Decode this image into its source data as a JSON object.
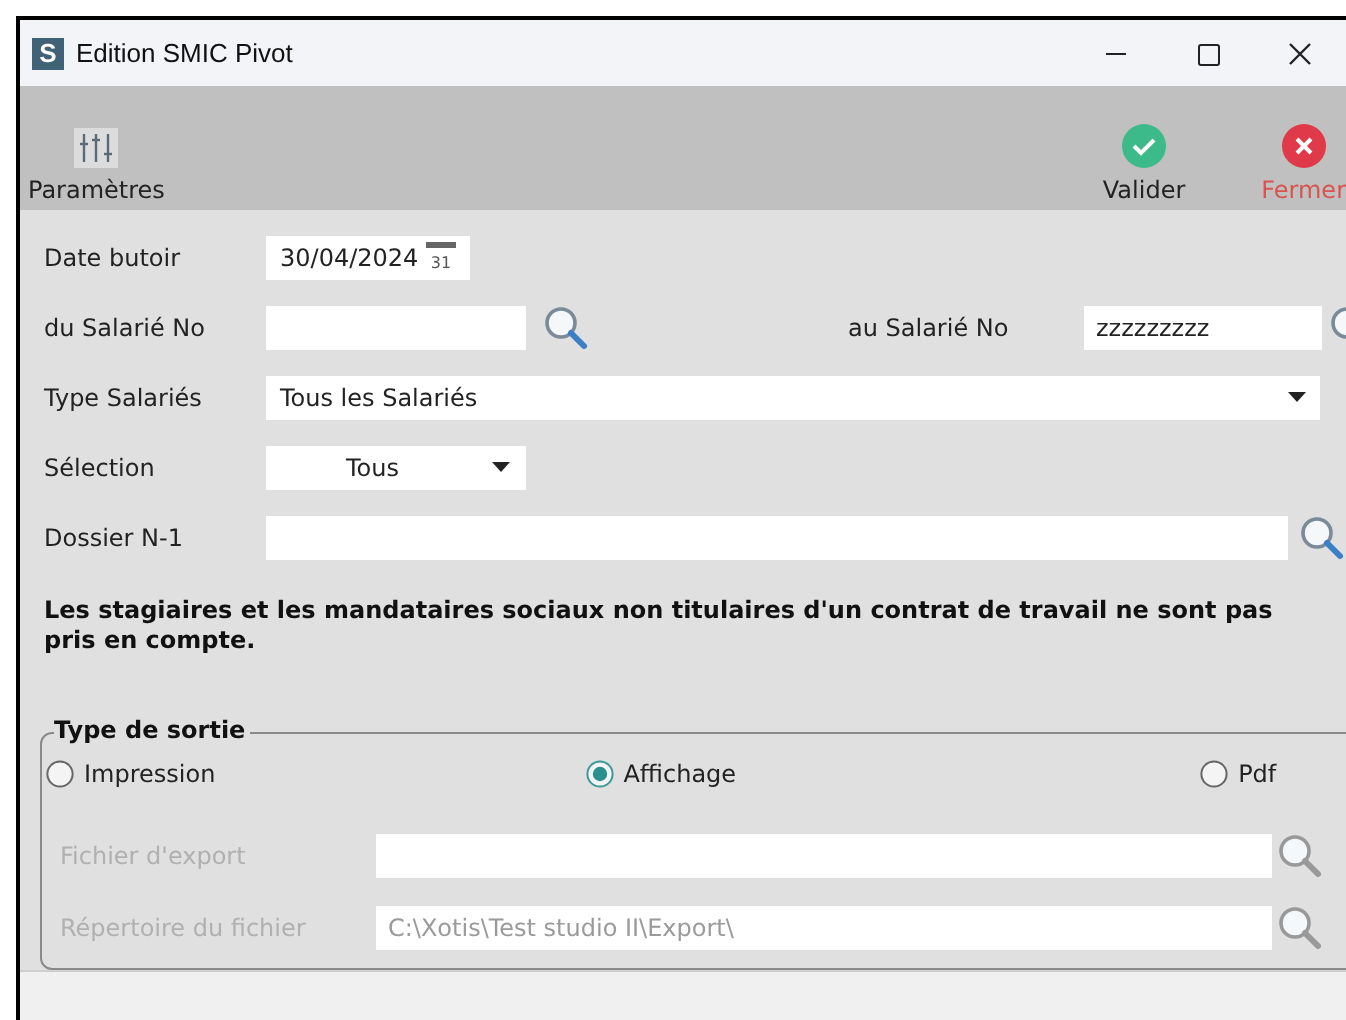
{
  "window": {
    "title": "Edition SMIC Pivot",
    "app_letter": "S"
  },
  "toolbar": {
    "left": [
      {
        "label": "Paramètres",
        "kind": "settings"
      }
    ],
    "right": [
      {
        "label": "Valider",
        "kind": "ok"
      },
      {
        "label": "Fermer",
        "kind": "close"
      }
    ]
  },
  "fields": [
    {
      "kind": "date",
      "label": "Date butoir",
      "value": "30/04/2024",
      "calendar_day": "31"
    },
    {
      "kind": "range",
      "label": "du Salarié No",
      "label2": "au Salarié No",
      "value2": "zzzzzzzzz"
    },
    {
      "kind": "select_wide",
      "label": "Type Salariés",
      "value": "Tous les Salariés"
    },
    {
      "kind": "select_small",
      "label": "Sélection",
      "value": "Tous"
    },
    {
      "kind": "search_wide",
      "label": "Dossier N-1"
    }
  ],
  "note": "Les stagiaires et les mandataires sociaux non titulaires d'un contrat de travail ne sont pas pris en compte.",
  "output": {
    "legend": "Type de sortie",
    "options": [
      {
        "label": "Impression",
        "selected": false
      },
      {
        "label": "Affichage",
        "selected": true
      },
      {
        "label": "Pdf",
        "selected": false
      }
    ],
    "files": [
      {
        "label": "Fichier d'export",
        "disabled": true
      },
      {
        "label": "Répertoire du fichier",
        "value": "C:\\Xotis\\Test studio II\\Export\\",
        "disabled": true
      }
    ]
  }
}
